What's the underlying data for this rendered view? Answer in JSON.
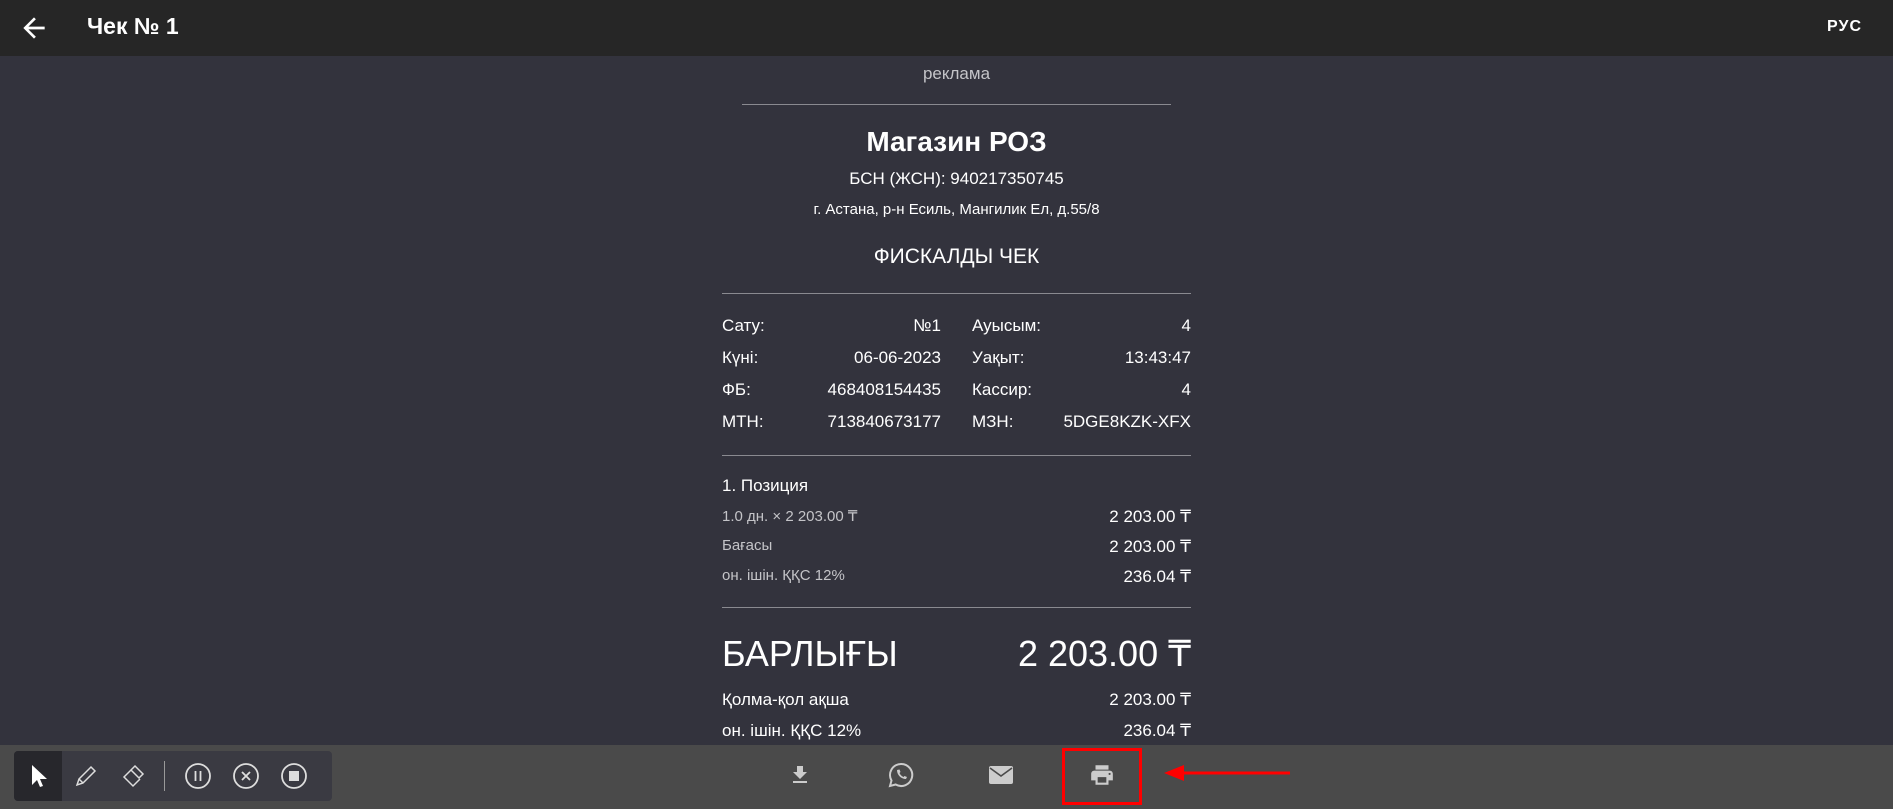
{
  "header": {
    "title": "Чек № 1",
    "lang": "РУС"
  },
  "receipt": {
    "ad": "реклама",
    "store": "Магазин РОЗ",
    "bin": "БСН (ЖСН): 940217350745",
    "address": "г. Астана, р-н Есиль, Мангилик Ел, д.55/8",
    "type": "ФИСКАЛДЫ ЧЕК",
    "info": [
      {
        "l1": "Сату:",
        "v1": "№1",
        "l2": "Ауысым:",
        "v2": "4"
      },
      {
        "l1": "Күні:",
        "v1": "06-06-2023",
        "l2": "Уақыт:",
        "v2": "13:43:47"
      },
      {
        "l1": "ФБ:",
        "v1": "468408154435",
        "l2": "Кассир:",
        "v2": "4"
      },
      {
        "l1": "МТН:",
        "v1": "713840673177",
        "l2": "МЗН:",
        "v2": "5DGE8KZK-XFX"
      }
    ],
    "position": {
      "title": "1. Позиция",
      "qty": "1.0 дн. × 2 203.00 ₸",
      "qty_value": "2 203.00 ₸",
      "price_label": "Бағасы",
      "price_value": "2 203.00 ₸",
      "vat_label": "он. ішін. ҚҚС 12%",
      "vat_value": "236.04 ₸"
    },
    "total_label": "БАРЛЫҒЫ",
    "total_value": "2 203.00 ₸",
    "cash_label": "Қолма-қол ақша",
    "cash_value": "2 203.00 ₸",
    "total_vat_label": "он. ішін. ҚҚС 12%",
    "total_vat_value": "236.04 ₸"
  },
  "colors": {
    "highlight": "#ff0000"
  }
}
